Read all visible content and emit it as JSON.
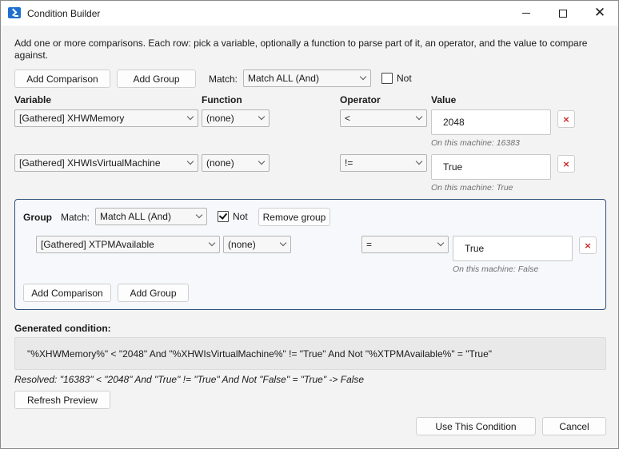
{
  "window": {
    "title": "Condition Builder"
  },
  "description": "Add one or more comparisons. Each row: pick a variable, optionally a function to parse part of it, an operator, and the value to compare against.",
  "toolbar": {
    "add_comparison": "Add Comparison",
    "add_group": "Add Group",
    "match_label": "Match:",
    "match_value": "Match ALL (And)",
    "not_label": "Not",
    "not_checked": false
  },
  "columns": {
    "variable": "Variable",
    "function": "Function",
    "operator": "Operator",
    "value": "Value"
  },
  "rows": [
    {
      "variable": "[Gathered] XHWMemory",
      "function": "(none)",
      "operator": "<",
      "value": "2048",
      "hint": "On this machine: 16383",
      "delete": "×"
    },
    {
      "variable": "[Gathered] XHWIsVirtualMachine",
      "function": "(none)",
      "operator": "!=",
      "value": "True",
      "hint": "On this machine: True",
      "delete": "×"
    }
  ],
  "group": {
    "label": "Group",
    "match_label": "Match:",
    "match_value": "Match ALL (And)",
    "not_label": "Not",
    "not_checked": true,
    "remove_label": "Remove group",
    "rows": [
      {
        "variable": "[Gathered] XTPMAvailable",
        "function": "(none)",
        "operator": "=",
        "value": "True",
        "hint": "On this machine: False",
        "delete": "×"
      }
    ],
    "add_comparison": "Add Comparison",
    "add_group": "Add Group"
  },
  "generated": {
    "label": "Generated condition:",
    "text": "\"%XHWMemory%\" < \"2048\" And \"%XHWIsVirtualMachine%\" != \"True\" And Not \"%XTPMAvailable%\" = \"True\"",
    "resolved": "Resolved: \"16383\" < \"2048\" And \"True\" != \"True\" And Not \"False\" = \"True\"  ->  False"
  },
  "buttons": {
    "refresh": "Refresh Preview",
    "use": "Use This Condition",
    "cancel": "Cancel"
  },
  "colors": {
    "accent": "#2f4f79",
    "delete": "#d11a1a",
    "app_icon": "#1f6fd1"
  }
}
